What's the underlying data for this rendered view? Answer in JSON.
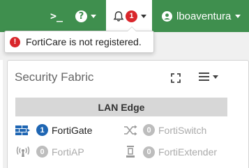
{
  "topbar": {
    "cli_glyph": ">_",
    "help_glyph": "?",
    "notifications_count": "1",
    "username": "lboaventura",
    "bg_color": "#3f8f4e"
  },
  "notification": {
    "warn_glyph": "!",
    "message": "FortiCare is not registered."
  },
  "widget": {
    "title": "Security Fabric",
    "header": "LAN Edge",
    "items": [
      {
        "icon": "fortigate-icon",
        "count": "1",
        "label": "FortiGate",
        "active": true
      },
      {
        "icon": "fortiswitch-icon",
        "count": "0",
        "label": "FortiSwitch",
        "active": false
      },
      {
        "icon": "fortiap-icon",
        "count": "0",
        "label": "FortiAP",
        "active": false
      },
      {
        "icon": "fortiextender-icon",
        "count": "0",
        "label": "FortiExtender",
        "active": false
      }
    ]
  }
}
